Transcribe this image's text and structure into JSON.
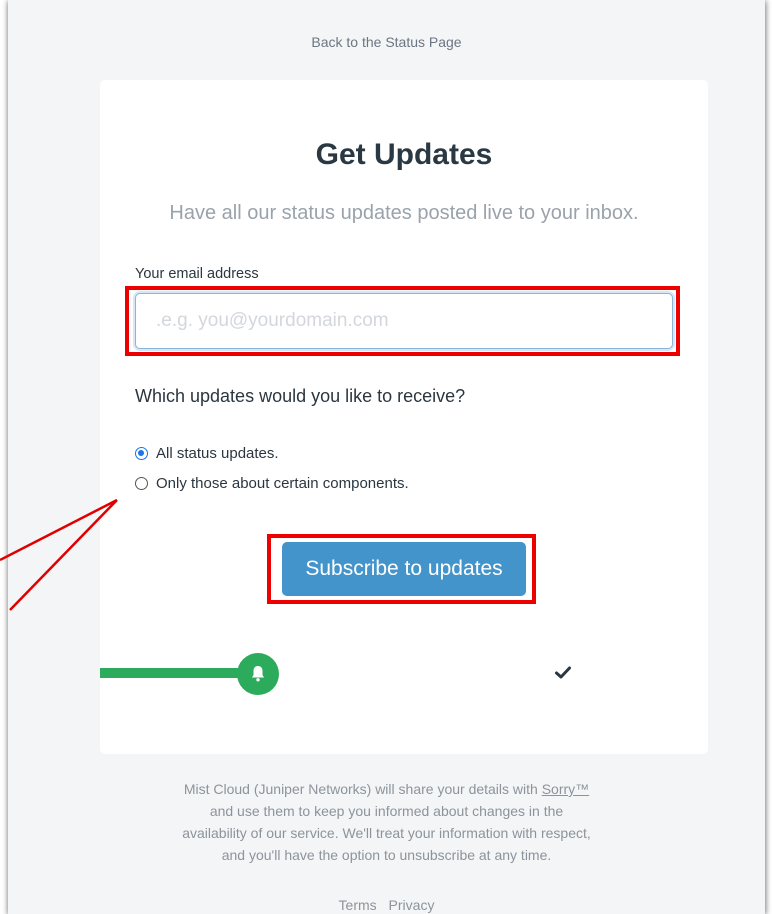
{
  "header": {
    "back_link": "Back to the Status Page"
  },
  "card": {
    "title": "Get Updates",
    "subtitle": "Have all our status updates posted live to your inbox.",
    "email_label": "Your email address",
    "email_placeholder": ".e.g. you@yourdomain.com",
    "email_value": "",
    "question": "Which updates would you like to receive?",
    "options": [
      {
        "label": "All status updates.",
        "selected": true
      },
      {
        "label": "Only those about certain components.",
        "selected": false
      }
    ],
    "subscribe_label": "Subscribe to updates",
    "progress": {
      "step": 1,
      "total_steps": 2,
      "current_icon": "bell-icon",
      "final_icon": "check-icon"
    }
  },
  "footer": {
    "disclosure_line1_prefix": "Mist Cloud (Juniper Networks) will share your details with ",
    "disclosure_brand": "Sorry™",
    "disclosure_line2": "and use them to keep you informed about changes in the",
    "disclosure_line3": "availability of our service. We'll treat your information with respect,",
    "disclosure_line4": "and you'll have the option to unsubscribe at any time.",
    "terms": "Terms",
    "privacy": "Privacy"
  },
  "colors": {
    "accent_blue": "#4494cc",
    "success_green": "#2dab5c",
    "annotation_red": "#ec0000",
    "title_dark": "#293842"
  }
}
